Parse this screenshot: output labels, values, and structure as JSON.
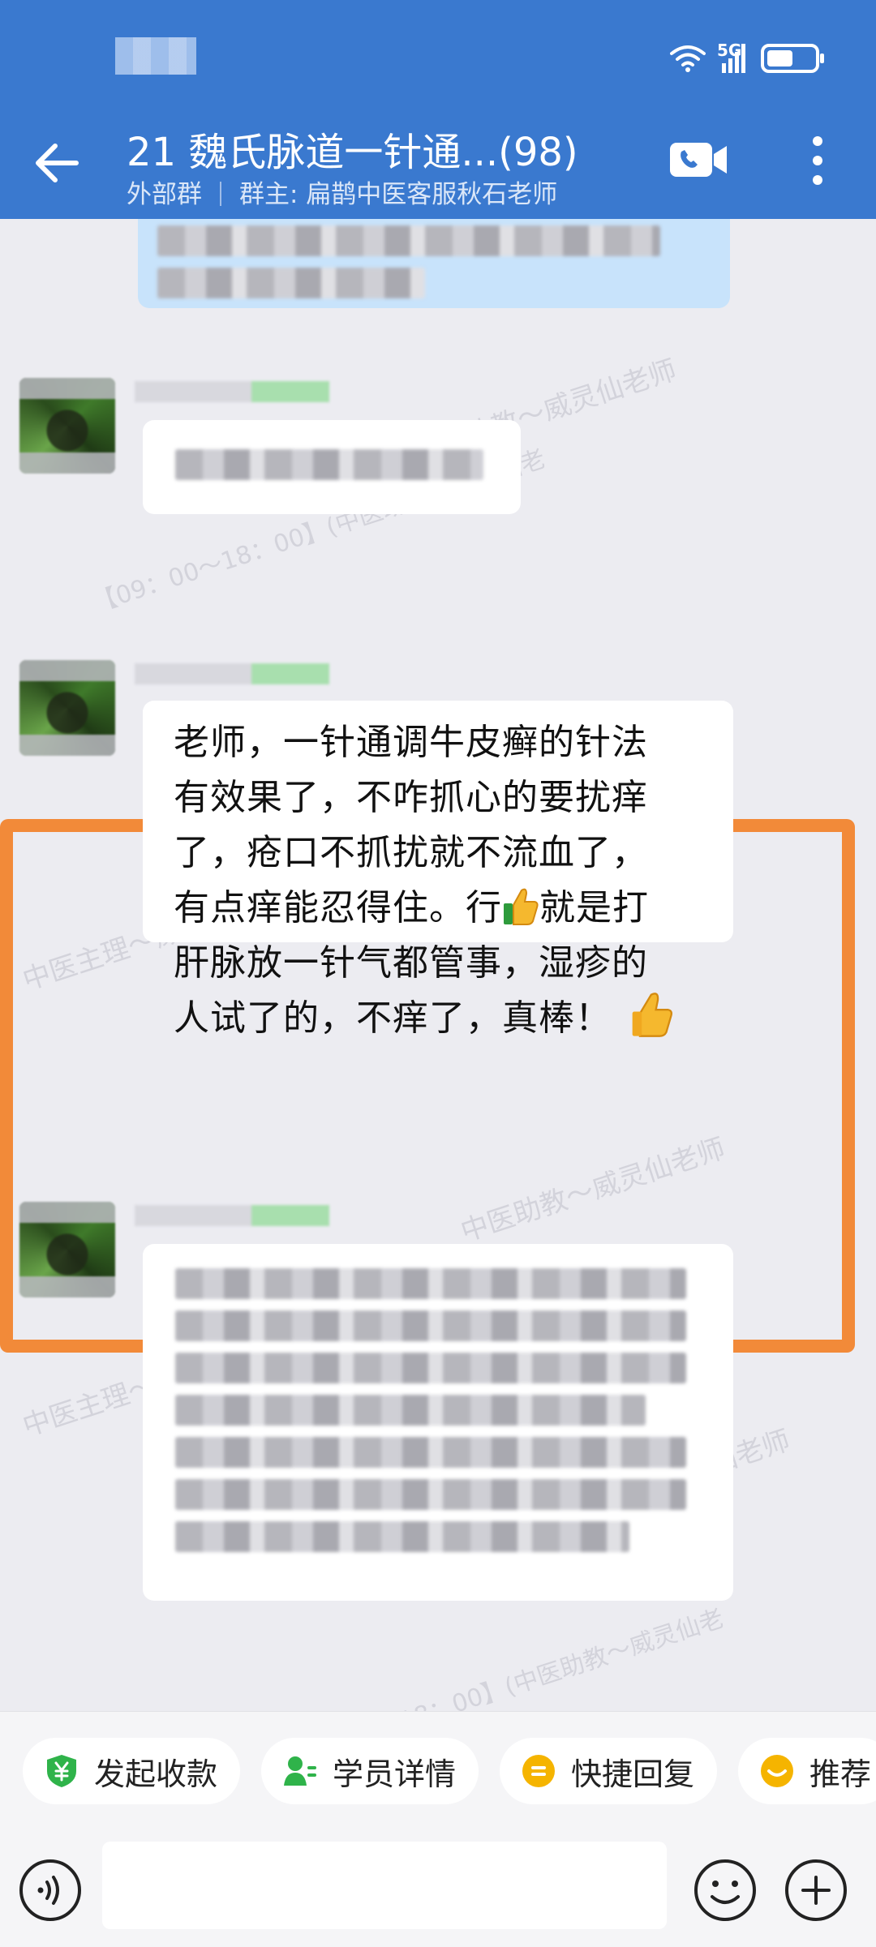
{
  "status_bar": {
    "network": "5G",
    "battery_level": 0.55
  },
  "header": {
    "title": "21 魏氏脉道一针通...(98)",
    "subtitle_tag": "外部群",
    "subtitle_owner": "群主: 扁鹊中医客服秋石老师",
    "icons": [
      "back-arrow-icon",
      "video-call-icon",
      "more-vertical-icon"
    ]
  },
  "watermark": {
    "line1": "中医助教～威灵仙老师",
    "line2": "【09：00～18：00】(中医助教～威灵仙老",
    "line3": "中医主理～威灵仙老师"
  },
  "messages": [
    {
      "id": "m0",
      "blurred": true,
      "style": "blue"
    },
    {
      "id": "m1",
      "blurred": true,
      "style": "white"
    },
    {
      "id": "m2",
      "blurred": false,
      "highlighted": true,
      "text_lines": [
        "老师，一针通调牛皮癣的针法",
        "有效果了，不咋抓心的要扰痒",
        "了，疮口不抓扰就不流血了，",
        "有点痒能忍得住。行",
        "就是打",
        "肝脉放一针气都管事，湿疹的",
        "人试了的，不痒了，真棒！"
      ],
      "emoji": "thumbs-up"
    },
    {
      "id": "m3",
      "blurred": true,
      "style": "white"
    }
  ],
  "quick_actions": [
    {
      "label": "发起收款",
      "icon": "yuan-shield-icon",
      "color": "#2fb34a"
    },
    {
      "label": "学员详情",
      "icon": "person-list-icon",
      "color": "#2fb34a"
    },
    {
      "label": "快捷回复",
      "icon": "quick-reply-icon",
      "color": "#f5b400"
    },
    {
      "label": "推荐",
      "icon": "recommend-icon",
      "color": "#f5b400"
    }
  ],
  "input": {
    "placeholder": "",
    "value": ""
  },
  "colors": {
    "header": "#3a79cf",
    "highlight": "#f28a39",
    "chat_bg": "#ececf1"
  }
}
